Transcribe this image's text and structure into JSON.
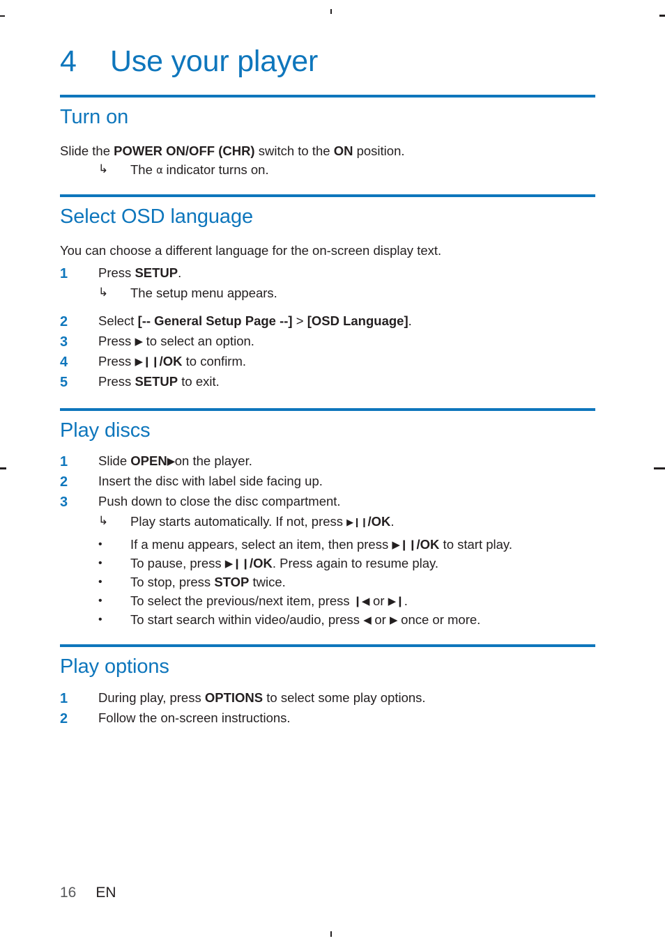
{
  "page": {
    "chapter_number": "4",
    "chapter_title": "Use your player",
    "footer_page_number": "16",
    "footer_language": "EN",
    "accent_color": "#0e76bc",
    "text_color": "#231f20"
  },
  "sections": [
    {
      "heading": "Turn on",
      "intro_prefix": "Slide the ",
      "intro_bold": "POWER ON/OFF (CHR)",
      "intro_mid": " switch to the ",
      "intro_bold2": "ON",
      "intro_suffix": " position.",
      "note_marker": "↳",
      "note_prefix": "The ",
      "note_icon": "power-symbol",
      "note_suffix": " indicator turns on."
    },
    {
      "heading": "Select OSD language",
      "intro": "You can choose a different language for the on-screen display text.",
      "steps": [
        {
          "num": "1",
          "prefix": "Press ",
          "bold": "SETUP",
          "suffix": "."
        },
        {
          "num": "2",
          "prefix": "Select ",
          "bold": "[-- General Setup Page --]",
          "mid": " > ",
          "bold2": "[OSD Language]",
          "suffix": "."
        },
        {
          "num": "3",
          "prefix": "Press ",
          "glyph": "▶",
          "suffix": " to select an option."
        },
        {
          "num": "4",
          "prefix": "Press ",
          "glyph": "▶❙❙",
          "bold": "/OK",
          "suffix": " to confirm."
        },
        {
          "num": "5",
          "prefix": "Press ",
          "bold": "SETUP",
          "suffix": " to exit."
        }
      ],
      "note_marker": "↳",
      "note_text": "The setup menu appears."
    },
    {
      "heading": "Play discs",
      "steps": [
        {
          "num": "1",
          "prefix": "Slide ",
          "bold": "OPEN",
          "glyph": "▶",
          "suffix": "on the player."
        },
        {
          "num": "2",
          "prefix": "Insert the disc with label side facing up.",
          "bold": "",
          "suffix": ""
        },
        {
          "num": "3",
          "prefix": "Push down to close the disc compartment.",
          "bold": "",
          "suffix": ""
        }
      ],
      "note_marker": "↳",
      "note_prefix": "Play starts automatically. If not, press ",
      "note_glyph": "▶❙❙",
      "note_bold": "/OK",
      "note_suffix": ".",
      "bullets": [
        {
          "marker": "•",
          "prefix": "If a menu appears, select an item, then press ",
          "glyph": "▶❙❙",
          "bold": "/OK",
          "suffix": " to start play."
        },
        {
          "marker": "•",
          "prefix": "To pause, press ",
          "glyph": "▶❙❙",
          "bold": "/OK",
          "suffix": ". Press again to resume play."
        },
        {
          "marker": "•",
          "prefix": "To stop, press ",
          "bold": "STOP",
          "suffix": " twice."
        },
        {
          "marker": "•",
          "prefix": "To select the previous/next item, press ",
          "glyph": "❙◀",
          "mid": " or ",
          "glyph2": "▶❙",
          "suffix": "."
        },
        {
          "marker": "•",
          "prefix": "To start search within video/audio, press ",
          "glyph": "◀",
          "mid": " or ",
          "glyph2": "▶",
          "suffix": " once or more."
        }
      ]
    },
    {
      "heading": "Play options",
      "steps": [
        {
          "num": "1",
          "prefix": "During play, press ",
          "bold": "OPTIONS",
          "suffix": " to select some play options."
        },
        {
          "num": "2",
          "prefix": "Follow the on-screen instructions.",
          "bold": "",
          "suffix": ""
        }
      ]
    }
  ]
}
